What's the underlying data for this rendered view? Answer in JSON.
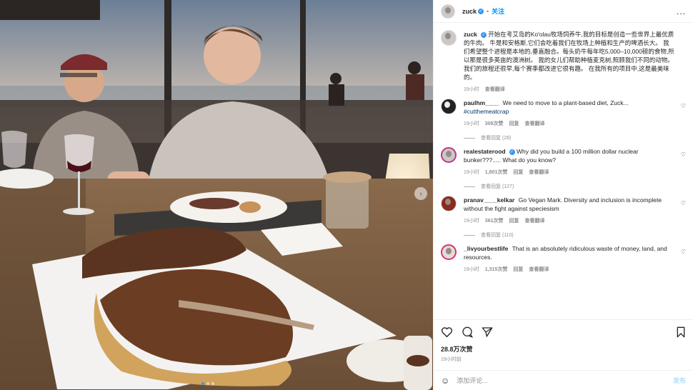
{
  "header": {
    "username": "zuck",
    "follow_label": "关注",
    "dot": "•",
    "more": "..."
  },
  "caption": {
    "username": "zuck",
    "text": "开始在考艾岛的Ko'olau牧场饲养牛,我的目标是创造一些世界上最优质的牛肉。 牛是和安格斯,它们会吃着我们在牧场上种植和生产的啤酒长大。 我们希望整个进程是本地的,垂直融合。每头奶牛每年吃5,000–10,000磅的食物,所以那是很多英亩的澳洲树。 我的女儿们帮助种植麦克树,照顾我们不同的动物。 我们的旅程还很早,每个赛季都改进它很有趣。 在我所有的项目中,这是最美味的。",
    "time": "19小时",
    "translate": "查看翻译"
  },
  "comments": [
    {
      "username": "paulhm____",
      "text": "We need to move to a plant-based diet, Zuck...",
      "hashtag": "#cutthemeatcrap",
      "time": "19小时",
      "likes": "308次赞",
      "reply": "回复",
      "translate": "查看翻译",
      "view_replies": "查看回复 (28)"
    },
    {
      "username": "realestaterood",
      "text": "Why did you build a 100 million dollar nuclear bunker???..... What do you know?",
      "time": "19小时",
      "likes": "1,801次赞",
      "reply": "回复",
      "translate": "查看翻译",
      "view_replies": "查看回复 (127)"
    },
    {
      "username": "pranav____kelkar",
      "text": "Go Vegan Mark. Diversity and inclusion is incomplete without the fight against speciesism",
      "time": "19小时",
      "likes": "361次赞",
      "reply": "回复",
      "translate": "查看翻译",
      "view_replies": "查看回复 (110)"
    },
    {
      "username": "_livyourbestlife",
      "text": "That is an absolutely ridiculous waste of money, land, and resources.",
      "time": "19小时",
      "likes": "1,315次赞",
      "reply": "回复",
      "translate": "查看翻译"
    }
  ],
  "post": {
    "likes": "28.8万次赞",
    "time": "19小时前"
  },
  "add_comment": {
    "placeholder": "添加评论...",
    "post_label": "发布"
  },
  "icons": {
    "like": "heart-icon",
    "comment": "comment-icon",
    "share": "send-icon",
    "save": "bookmark-icon",
    "emoji": "emoji-icon",
    "next": "chevron-right-icon"
  },
  "colors": {
    "accent": "#0095f6",
    "verified": "#3897f0",
    "muted": "#8e8e8e"
  }
}
